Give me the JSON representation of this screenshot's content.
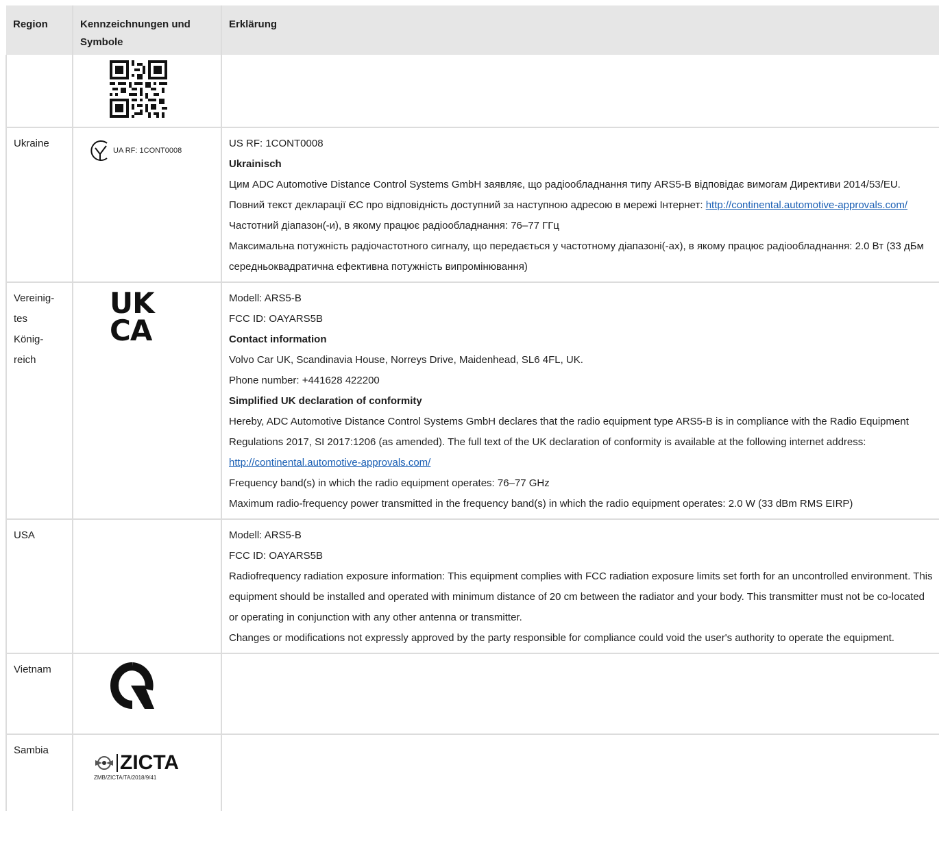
{
  "header": {
    "col_region": "Region",
    "col_marks": "Kennzeichnungen und Symbole",
    "col_explanation": "Erklärung"
  },
  "rows": {
    "qr": {
      "region": ""
    },
    "ukraine": {
      "region": "Ukraine",
      "mark_text": "UA RF: 1CONT0008",
      "l1": "US RF: 1CONT0008",
      "h1": "Ukrainisch",
      "p1": "Цим ADC Automotive Distance Control Systems GmbH заявляє, що радіообладнання типу ARS5-B відповідає вимогам Директиви 2014/53/EU. Повний текст декларації ЄС про відповідність доступний за наступною адресою в мережі Інтернет: ",
      "link": "http://continental.automotive-approvals.com/",
      "l2": "Частотний діапазон(-и), в якому працює радіообладнання: 76–77 ГГц",
      "l3": "Максимальна потужність радіочастотного сигналу, що передається у частотному діапазоні(-ах), в якому працює радіообладнання: 2.0 Вт (33 дБм середньоквадратична ефективна потужність випромінювання)"
    },
    "uk": {
      "region": "Vereinig-\ntes\nKönig-\nreich",
      "logo_top": "UK",
      "logo_bottom": "CA",
      "l1": "Modell: ARS5-B",
      "l2": "FCC ID: OAYARS5B",
      "h1": "Contact information",
      "l3": "Volvo Car UK, Scandinavia House, Norreys Drive, Maidenhead, SL6 4FL, UK.",
      "l4": "Phone number: +441628 422200",
      "h2": "Simplified UK declaration of conformity",
      "p1": "Hereby, ADC Automotive Distance Control Systems GmbH declares that the radio equipment type ARS5-B is in compliance with the Radio Equipment Regulations 2017, SI 2017:1206 (as amended). The full text of the UK declaration of conformity is available at the following internet address: ",
      "link": "http://continental.automotive-approvals.com/",
      "l5": "Frequency band(s) in which the radio equipment operates: 76–77 GHz",
      "l6": "Maximum radio-frequency power transmitted in the frequency band(s) in which the radio equipment operates: 2.0 W (33 dBm RMS EIRP)"
    },
    "usa": {
      "region": "USA",
      "l1": "Modell: ARS5-B",
      "l2": "FCC ID: OAYARS5B",
      "p1": "Radiofrequency radiation exposure information: This equipment complies with FCC radiation exposure limits set forth for an uncontrolled environment. This equipment should be installed and operated with minimum distance of 20 cm between the radiator and your body. This transmitter must not be co-located or operating in conjunction with any other antenna or transmitter.",
      "p2": "Changes or modifications not expressly approved by the party responsible for compliance could void the user's authority to operate the equipment."
    },
    "vietnam": {
      "region": "Vietnam"
    },
    "zambia": {
      "region": "Sambia",
      "logo_text": "ZICTA",
      "logo_sub": "ZMB/ZICTA/TA/2018/9/41"
    }
  }
}
